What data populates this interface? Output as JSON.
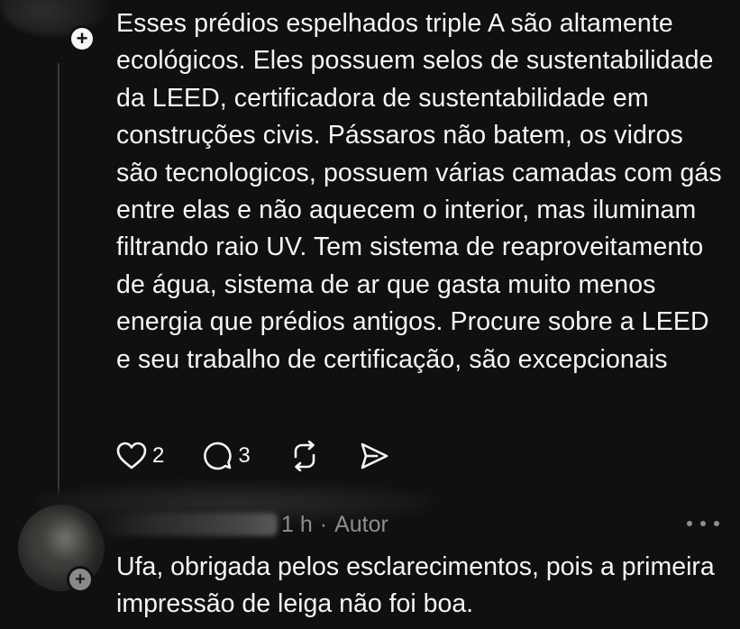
{
  "post": {
    "text": "Esses prédios espelhados triple A são altamente ecológicos. Eles possuem selos de sustentabilidade da LEED, certificadora de sustentabilidade em construções civis. Pássaros não batem, os vidros são tecnologicos, possuem várias camadas com gás entre elas e não aquecem o interior, mas iluminam filtrando raio UV. Tem sistema de reaproveitamento de água, sistema de ar que gasta muito menos energia que prédios antigos. Procure sobre a LEED e seu trabalho de certificação, são excepcionais",
    "like_count": "2",
    "reply_count": "3",
    "follow_badge": "+"
  },
  "icons": {
    "like": "heart-icon",
    "reply": "comment-icon",
    "repost": "repost-icon",
    "share": "send-icon",
    "more": "more-icon"
  },
  "reply": {
    "time": "1 h",
    "separator": "·",
    "role": "Autor",
    "text": "Ufa, obrigada pelos esclarecimentos, pois a primeira impressão de leiga não foi boa.",
    "badge": "+"
  },
  "colors": {
    "background": "#101010",
    "text": "#f3f5f7",
    "muted": "#8e8e8e",
    "thread_line": "#3a3a3a"
  }
}
